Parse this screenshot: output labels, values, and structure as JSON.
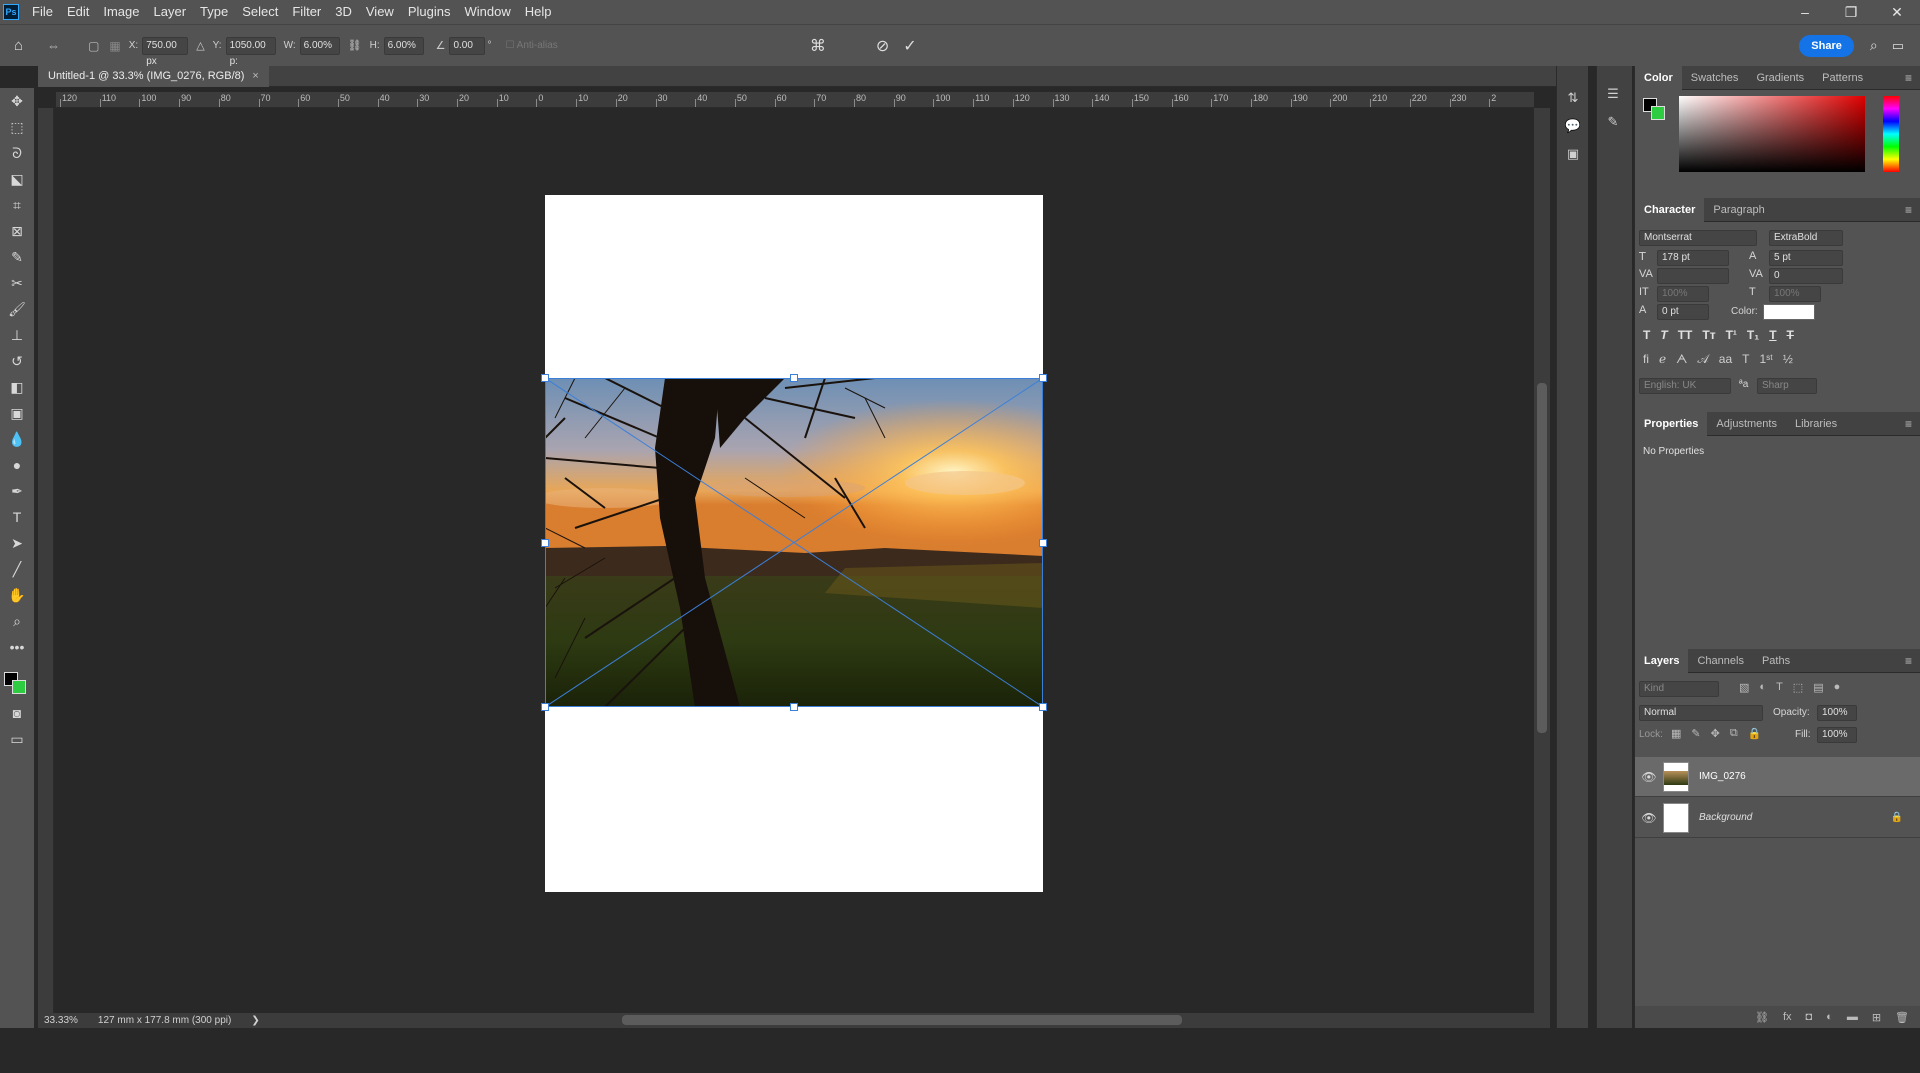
{
  "app": {
    "logo": "Ps"
  },
  "menu": [
    "File",
    "Edit",
    "Image",
    "Layer",
    "Type",
    "Select",
    "Filter",
    "3D",
    "View",
    "Plugins",
    "Window",
    "Help"
  ],
  "window_controls": {
    "minimize": "–",
    "restore": "❐",
    "close": "✕"
  },
  "options": {
    "x_label": "X:",
    "x_value": "750.00 px",
    "y_label": "Y:",
    "y_value": "1050.00 p:",
    "w_label": "W:",
    "w_value": "6.00%",
    "h_label": "H:",
    "h_value": "6.00%",
    "angle_value": "0.00",
    "angle_unit": "°",
    "antialias": "Anti-alias",
    "share": "Share"
  },
  "document_tab": {
    "title": "Untitled-1 @ 33.3% (IMG_0276, RGB/8)",
    "close": "×"
  },
  "ruler_h_labels": [
    "120",
    "110",
    "100",
    "90",
    "80",
    "70",
    "60",
    "50",
    "40",
    "30",
    "20",
    "10",
    "0",
    "10",
    "20",
    "30",
    "40",
    "50",
    "60",
    "70",
    "80",
    "90",
    "100",
    "110",
    "120",
    "130",
    "140",
    "150",
    "160",
    "170",
    "180",
    "190",
    "200",
    "210",
    "220",
    "230",
    "2"
  ],
  "status": {
    "zoom": "33.33%",
    "doc_info": "127 mm x 177.8 mm (300 ppi)",
    "arrow": "❯"
  },
  "panels": {
    "color_tabs": [
      "Color",
      "Swatches",
      "Gradients",
      "Patterns"
    ],
    "character_tabs": [
      "Character",
      "Paragraph"
    ],
    "character": {
      "font_family": "Montserrat",
      "font_style": "ExtraBold",
      "font_size": "178 pt",
      "leading": "5 pt",
      "tracking": "0",
      "vertical_scale": "100%",
      "horizontal_scale": "100%",
      "baseline_shift": "0 pt",
      "color_label": "Color:",
      "language": "English: UK",
      "antialias": "Sharp",
      "aa_icon": "ªa"
    },
    "properties_tabs": [
      "Properties",
      "Adjustments",
      "Libraries"
    ],
    "properties_text": "No Properties",
    "layers_tabs": [
      "Layers",
      "Channels",
      "Paths"
    ],
    "layers": {
      "filter_placeholder": "Kind",
      "blend_mode": "Normal",
      "opacity_label": "Opacity:",
      "opacity": "100%",
      "lock_label": "Lock:",
      "fill_label": "Fill:",
      "fill": "100%",
      "items": [
        {
          "name": "IMG_0276"
        },
        {
          "name": "Background"
        }
      ]
    }
  },
  "colors": {
    "accent": "#1473e6",
    "selection": "#3c7fd8",
    "foreground_swatch": "#000000",
    "background_swatch": "#2ecc40"
  }
}
